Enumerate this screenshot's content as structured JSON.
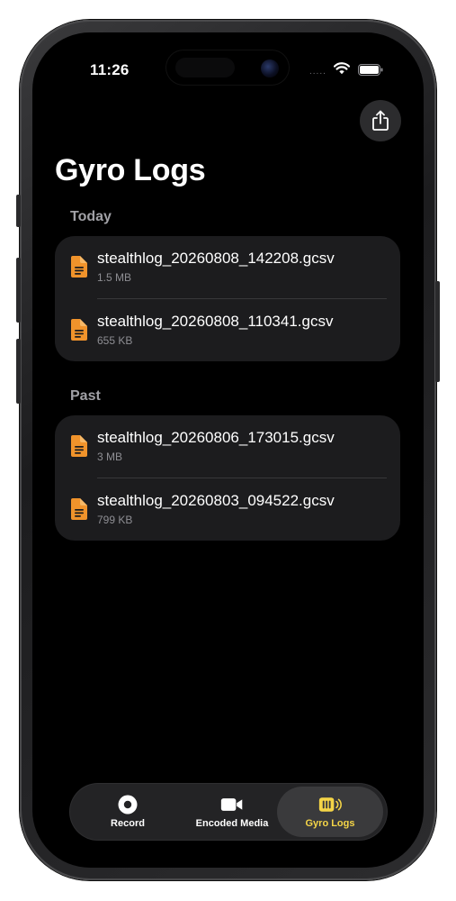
{
  "status_bar": {
    "time": "11:26",
    "signal": "....."
  },
  "page": {
    "title": "Gyro Logs"
  },
  "sections": [
    {
      "header": "Today",
      "files": [
        {
          "name": "stealthlog_20260808_142208.gcsv",
          "size": "1.5 MB"
        },
        {
          "name": "stealthlog_20260808_110341.gcsv",
          "size": "655 KB"
        }
      ]
    },
    {
      "header": "Past",
      "files": [
        {
          "name": "stealthlog_20260806_173015.gcsv",
          "size": "3 MB"
        },
        {
          "name": "stealthlog_20260803_094522.gcsv",
          "size": "799 KB"
        }
      ]
    }
  ],
  "tab_bar": {
    "tabs": [
      {
        "label": "Record",
        "icon": "record-icon"
      },
      {
        "label": "Encoded Media",
        "icon": "video-camera-icon"
      },
      {
        "label": "Gyro Logs",
        "icon": "gyro-log-icon",
        "selected": true
      }
    ]
  },
  "colors": {
    "file_icon": "#f0932b",
    "selected_tab": "#f5d547",
    "background": "#000000",
    "card": "#1c1c1e"
  },
  "icons": {
    "share": "share-icon",
    "file": "document-icon",
    "wifi": "wifi-icon",
    "battery": "battery-icon"
  }
}
